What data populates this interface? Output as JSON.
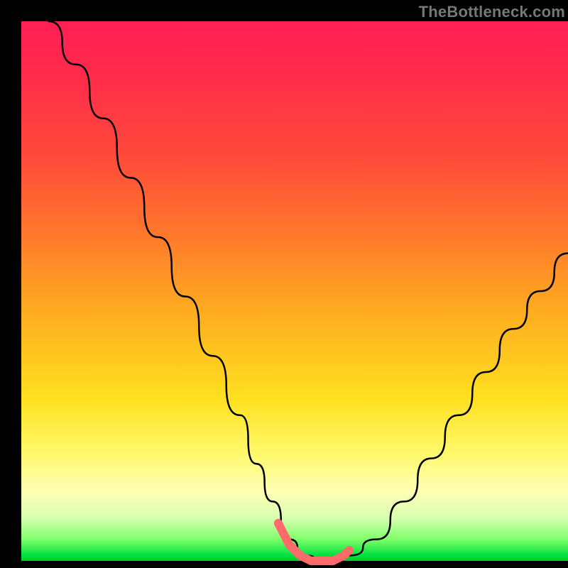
{
  "watermark": "TheBottleneck.com",
  "chart_data": {
    "type": "line",
    "title": "",
    "xlabel": "",
    "ylabel": "",
    "xlim": [
      0,
      100
    ],
    "ylim": [
      0,
      100
    ],
    "grid": false,
    "legend": false,
    "series": [
      {
        "name": "bottleneck-curve",
        "color": "#000000",
        "x": [
          5,
          10,
          15,
          20,
          25,
          30,
          35,
          40,
          43,
          46,
          49,
          52,
          55,
          58,
          60,
          65,
          70,
          75,
          80,
          85,
          90,
          95,
          100
        ],
        "y": [
          100,
          92,
          82,
          71,
          60,
          49,
          38,
          27,
          18,
          11,
          4,
          1,
          0,
          0,
          1,
          4,
          11,
          19,
          27,
          35,
          43,
          50,
          57
        ]
      },
      {
        "name": "valley-highlight",
        "color": "#ff6a6a",
        "x": [
          47,
          49,
          51,
          53,
          55,
          57,
          59,
          60
        ],
        "y": [
          7,
          3,
          1,
          0,
          0,
          0,
          1,
          2
        ]
      }
    ]
  }
}
